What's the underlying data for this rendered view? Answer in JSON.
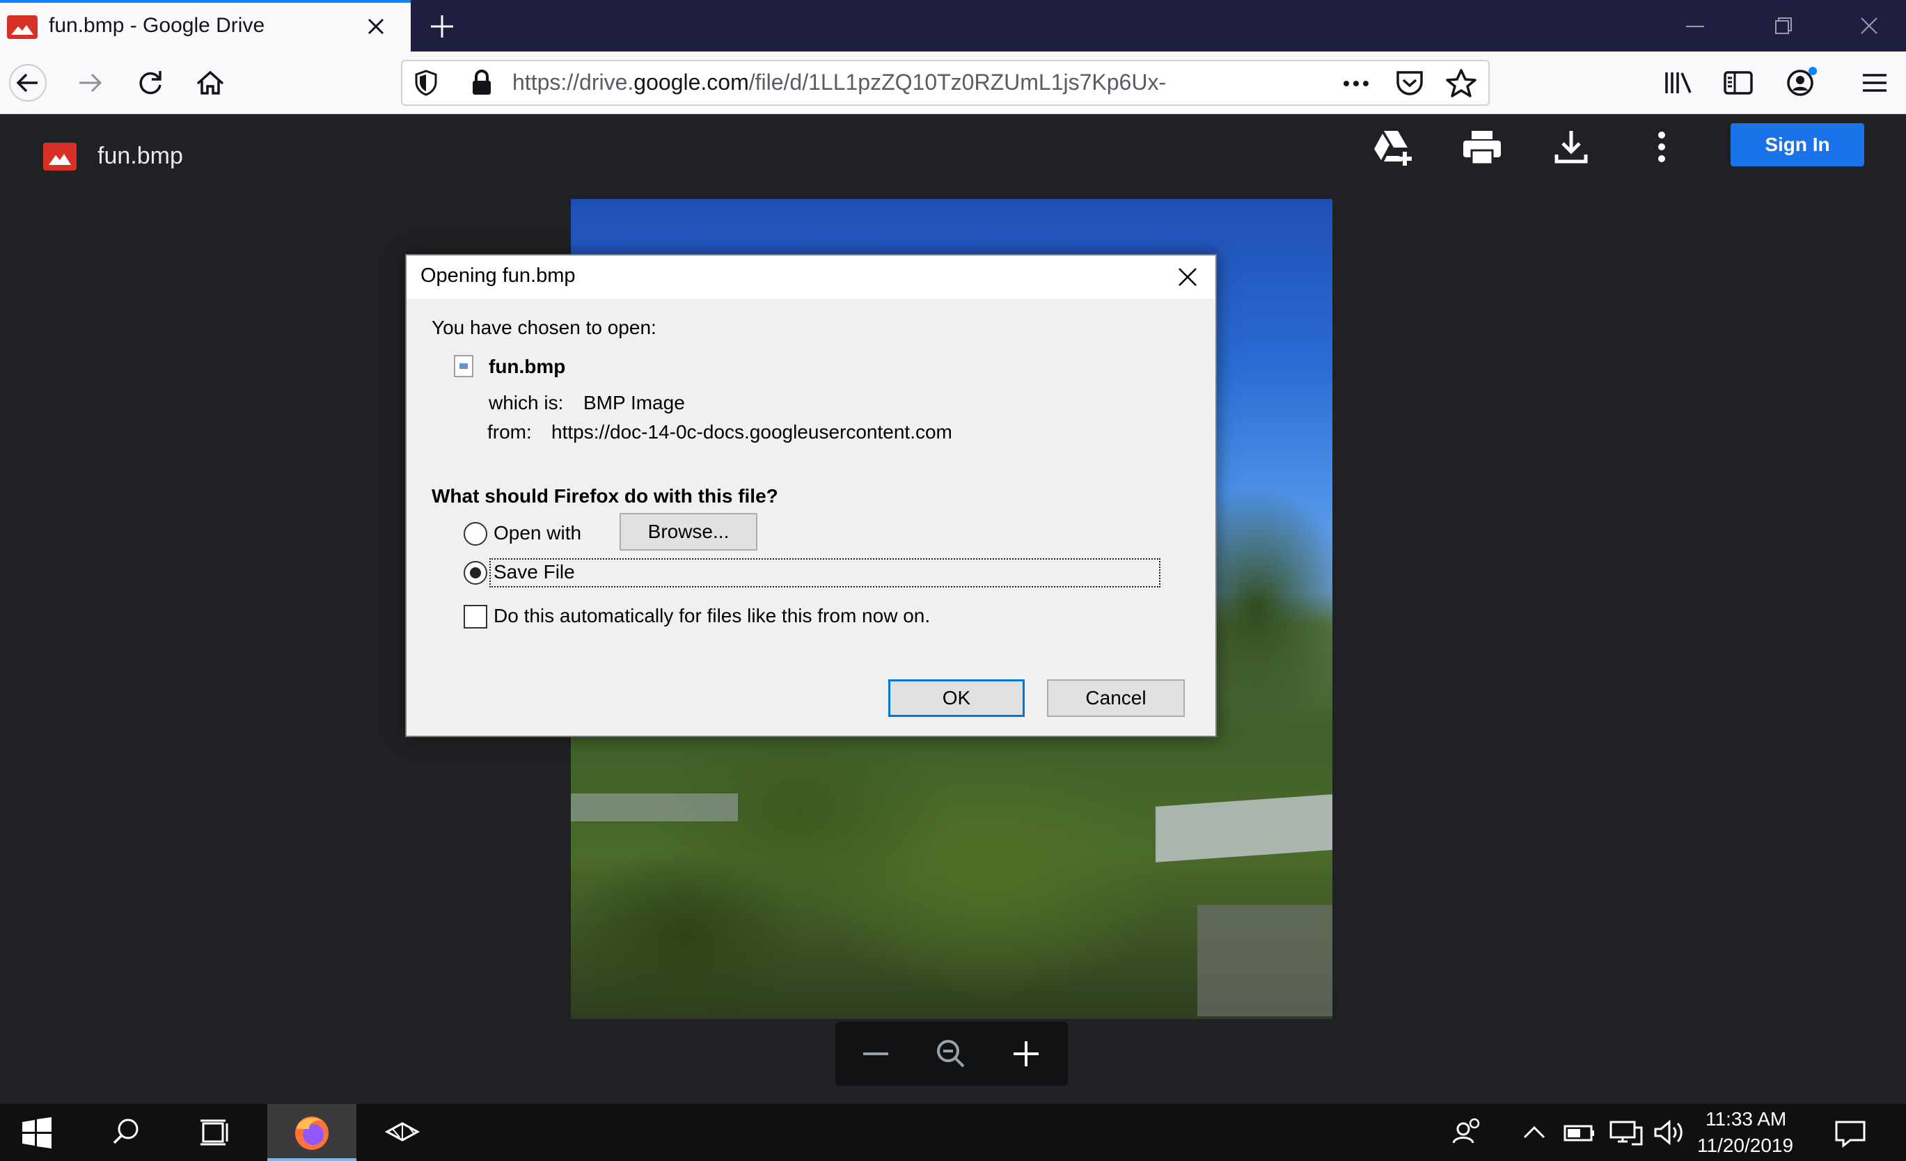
{
  "browser": {
    "tab_title": "fun.bmp - Google Drive",
    "url_prefix": "https://drive.",
    "url_domain": "google.com",
    "url_path": "/file/d/1LL1pzZQ10Tz0RZUmL1js7Kp6Ux-"
  },
  "drive": {
    "file_name": "fun.bmp",
    "sign_in_label": "Sign In"
  },
  "dialog": {
    "title": "Opening fun.bmp",
    "intro": "You have chosen to open:",
    "file_name": "fun.bmp",
    "which_is_label": "which is:",
    "which_is_value": "BMP Image",
    "from_label": "from:",
    "from_value": "https://doc-14-0c-docs.googleusercontent.com",
    "question": "What should Firefox do with this file?",
    "open_with_label": "Open with",
    "browse_label": "Browse...",
    "save_file_label": "Save File",
    "auto_label": "Do this automatically for files like this from now on.",
    "ok_label": "OK",
    "cancel_label": "Cancel",
    "selected_option": "save_file",
    "auto_checked": false
  },
  "taskbar": {
    "time": "11:33 AM",
    "date": "11/20/2019"
  },
  "colors": {
    "tab_accent": "#0a84ff",
    "drive_bg": "#202124",
    "sign_in_blue": "#1a73e8",
    "dialog_bg": "#f0f0f0",
    "ok_border": "#0078d7"
  }
}
